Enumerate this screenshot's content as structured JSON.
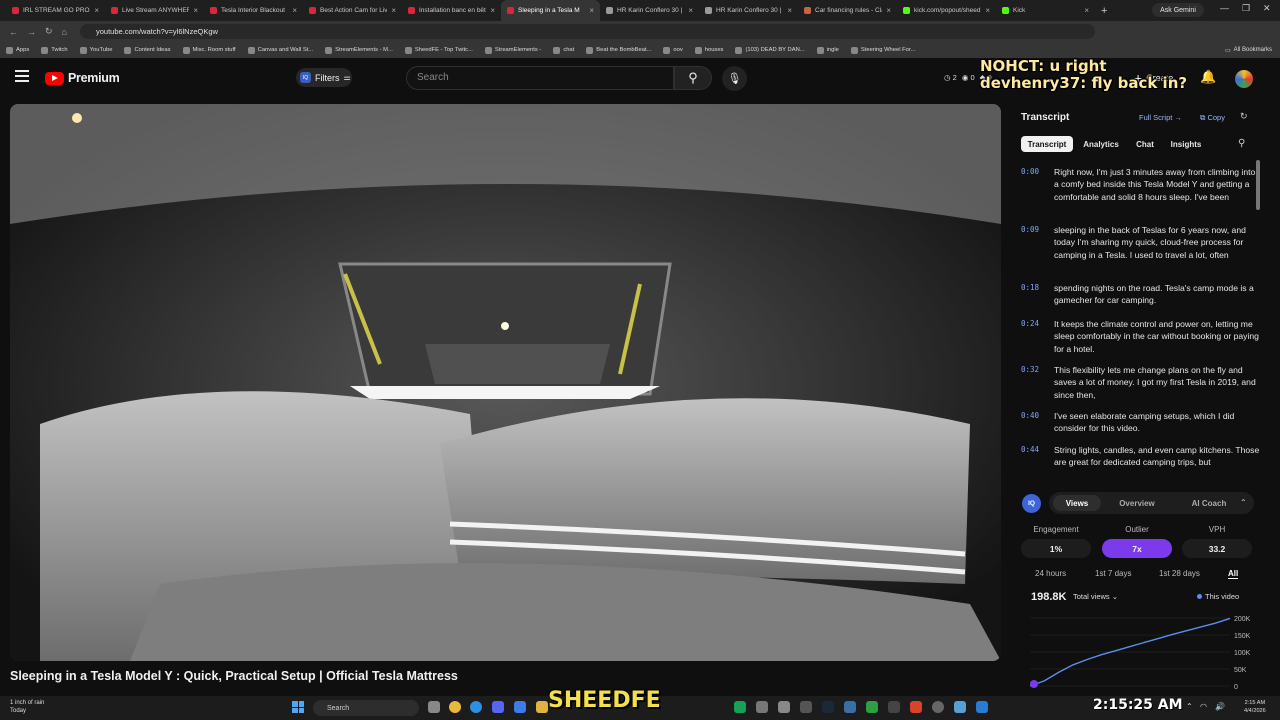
{
  "browser": {
    "tabs": [
      {
        "title": "IRL STREAM GO PRO H",
        "color": "#d9263b"
      },
      {
        "title": "Live Stream ANYWHER",
        "color": "#d9263b"
      },
      {
        "title": "Tesla Interior Blackout",
        "color": "#d9263b"
      },
      {
        "title": "Best Action Cam for Liv",
        "color": "#d9263b"
      },
      {
        "title": "Installation banc en bêt",
        "color": "#d9263b"
      },
      {
        "title": "Sleeping in a Tesla M",
        "color": "#d9263b"
      },
      {
        "title": "HR Karin Conflero 30 | ",
        "color": "#9a9a9a"
      },
      {
        "title": "HR Karin Conflero 30 | ",
        "color": "#9a9a9a"
      },
      {
        "title": "Car financing rules - Cla",
        "color": "#c96442"
      },
      {
        "title": "kick.com/popout/sheed",
        "color": "#53fc18"
      },
      {
        "title": "Kick",
        "color": "#53fc18"
      }
    ],
    "ask_gemini": "Ask Gemini",
    "url": "youtube.com/watch?v=yl6lNzeQKgw",
    "bookmarks": [
      "Apps",
      "Twitch",
      "YouTube",
      "Content Ideas",
      "Misc. Room stuff",
      "Canvas and Wall St...",
      "StreamElements - M...",
      "SheedFE - Top Twitc...",
      "StreamElements -",
      "chat",
      "Beat the BombBeat...",
      "oov",
      "houses",
      "(103) DEAD BY DAN...",
      "ingle",
      "Steering Wheel For..."
    ],
    "all_bookmarks": "All Bookmarks"
  },
  "youtube": {
    "logo_text": "Premium",
    "filters_label": "Filters",
    "filters_icon_text": "IQ",
    "search_placeholder": "Search",
    "header_stats": [
      "2",
      "0",
      "0"
    ],
    "create_label": "Create",
    "video_title": "Sleeping in a Tesla Model Y : Quick, Practical Setup | Official Tesla Mattress"
  },
  "stream_overlay": {
    "line1": "NOHCT: u right",
    "line2": "devhenry37: fly back in?",
    "brand": "SHEEDFE"
  },
  "transcript": {
    "title": "Transcript",
    "full_script": "Full Script →",
    "copy": "Copy",
    "tabs": [
      "Transcript",
      "Analytics",
      "Chat",
      "Insights"
    ],
    "segments": [
      {
        "time": "0:00",
        "text": "Right now, I'm just 3 minutes away from climbing into a comfy bed inside this Tesla Model Y and getting a comfortable and solid 8 hours sleep. I've been"
      },
      {
        "time": "0:09",
        "text": "sleeping in the back of Teslas for 6 years now, and today I'm sharing my quick, cloud-free process for camping in a Tesla. I used to travel a lot, often"
      },
      {
        "time": "0:18",
        "text": "spending nights on the road. Tesla's camp mode is a gamecher for car camping."
      },
      {
        "time": "0:24",
        "text": "It keeps the climate control and power on, letting me sleep comfortably in the car without booking or paying for a hotel."
      },
      {
        "time": "0:32",
        "text": "This flexibility lets me change plans on the fly and saves a lot of money. I got my first Tesla in 2019, and since then,"
      },
      {
        "time": "0:40",
        "text": "I've seen elaborate camping setups, which I did consider for this video."
      },
      {
        "time": "0:44",
        "text": "String lights, candles, and even camp kitchens. Those are great for dedicated camping trips, but"
      }
    ]
  },
  "analytics": {
    "logo": "IQ",
    "tabs": [
      "Views",
      "Overview",
      "AI Coach"
    ],
    "metrics": [
      {
        "label": "Engagement",
        "value": "1%"
      },
      {
        "label": "Outlier",
        "value": "7x"
      },
      {
        "label": "VPH",
        "value": "33.2"
      }
    ],
    "ranges": [
      "24 hours",
      "1st 7 days",
      "1st 28 days",
      "All"
    ],
    "views_total": "198.8K",
    "views_selector": "Total views",
    "legend": "This video",
    "accent": "#5b8def",
    "chart_data": {
      "type": "line",
      "title": "",
      "yticks": [
        "200K",
        "150K",
        "100K",
        "50K",
        "0"
      ],
      "ylim": [
        0,
        200000
      ],
      "series": [
        {
          "name": "This video",
          "values": [
            0,
            15000,
            40000,
            62000,
            78000,
            92000,
            104000,
            116000,
            128000,
            140000,
            152000,
            163000,
            174000,
            185000,
            198800
          ]
        }
      ]
    }
  },
  "taskbar": {
    "weather_line1": "1 inch of rain",
    "weather_line2": "Today",
    "search": "Search",
    "clock_big": "2:15:25 AM",
    "time": "2:15 AM",
    "date": "4/4/2026"
  }
}
